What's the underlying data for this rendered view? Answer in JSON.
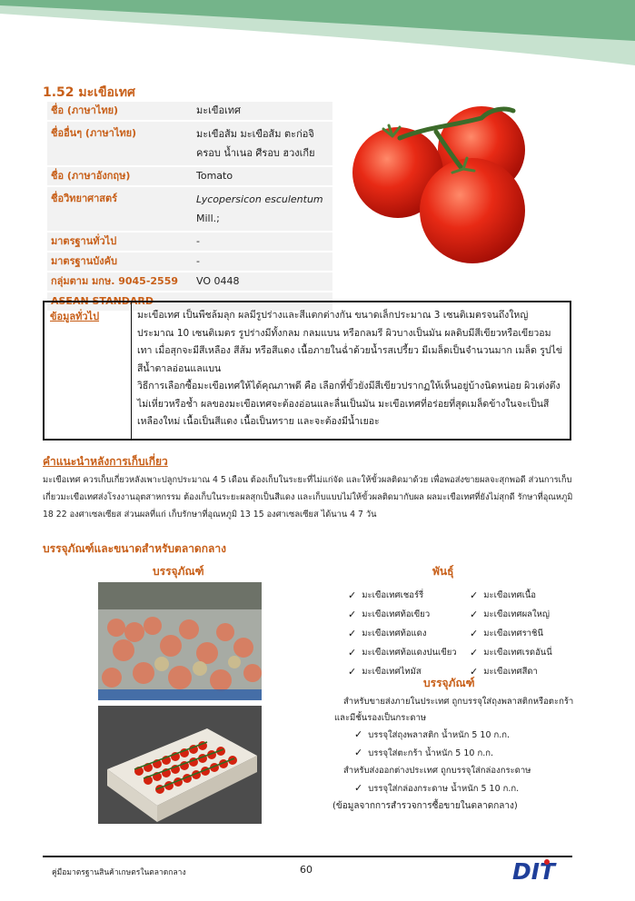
{
  "title": "1.52 มะเขือเทศ",
  "spec": [
    {
      "key": "ชื่อ (ภาษาไทย)",
      "value": "มะเขือเทศ"
    },
    {
      "key": "ชื่ออื่นๆ (ภาษาไทย)",
      "value": "มะเขือส้ม มะเขือส้ม ตะก่อจิ ครอบ น้ำเนอ ศีรอบ ฮวงเกีย"
    },
    {
      "key": "ชื่อ (ภาษาอังกฤษ)",
      "value": "Tomato"
    },
    {
      "key": "ชื่อวิทยาศาสตร์",
      "value_italic": "Lycopersicon esculentum",
      "value_suffix": " Mill.;"
    },
    {
      "key": "มาตรฐานทั่วไป",
      "value": "-"
    },
    {
      "key": "มาตรฐานบังคับ",
      "value": "-"
    },
    {
      "key": "กลุ่มตาม มกษ. 9045-2559",
      "value": "VO 0448"
    },
    {
      "key": "ASEAN STANDARD",
      "value": "-"
    }
  ],
  "general_info": {
    "label": "ข้อมูลทั่วไป",
    "text1": "มะเขือเทศ เป็นพืชล้มลุก ผลมีรูปร่างและสีแตกต่างกัน ขนาดเล็กประมาณ 3 เซนติเมตรจนถึงใหญ่ประมาณ 10 เซนติเมตร รูปร่างมีทั้งกลม กลมแบน หรือกลมรี ผิวบางเป็นมัน ผลดิบมีสีเขียวหรือเขียวอมเทา เมื่อสุกจะมีสีเหลือง สีส้ม หรือสีแดง เนื้อภายในฉ่ำด้วยน้ำรสเปรี้ยว มีเมล็ดเป็นจำนวนมาก เมล็ด รูปไข่สีน้ำตาลอ่อนแลแบน",
    "text2": "วิธีการเลือกซื้อมะเขือเทศให้ได้คุณภาพดี คือ เลือกที่ขั้วยังมีสีเขียวปรากฏให้เห็นอยู่บ้างนิดหน่อย ผิวเต่งตึง ไม่เหี่ยวหรือช้ำ ผลของมะเขือเทศจะต้องอ่อนและลื่นเป็นมัน มะเขือเทศที่อร่อยที่สุดเมล็ดข้างในจะเป็นสีเหลืองใหม่ เนื้อเป็นสีแดง เนื้อเป็นทราย และจะต้องมีน้ำเยอะ"
  },
  "harvest": {
    "heading": "คำแนะนำหลังการเก็บเกี่ยว",
    "text": "มะเขือเทศ ควรเก็บเกี่ยวหลังเพาะปลูกประมาณ 4 5 เดือน ต้องเก็บในระยะที่ไม่แก่จัด และให้ขั้วผลติดมาด้วย เพื่อพอส่งขายผลจะสุกพอดี ส่วนการเก็บเกี่ยวมะเขือเทศส่งโรงงานอุตสาหกรรม ต้องเก็บในระยะผลสุกเป็นสีแดง และเก็บแบบไม่ให้ขั้วผลติดมากับผล ผลมะเขือเทศที่ยังไม่สุกดี รักษาที่อุณหภูมิ 18 22 องศาเซลเซียส ส่วนผลที่แก่ เก็บรักษาที่อุณหภูมิ 13 15 องศาเซลเซียส ได้นาน 4 7 วัน"
  },
  "packaging": {
    "heading": "บรรจุภัณฑ์และขนาดสำหรับตลาดกลาง",
    "left_heading": "บรรจุภัณฑ์",
    "varieties_heading": "พันธุ์",
    "varieties": [
      [
        "มะเขือเทศเชอร์รี่",
        "มะเขือเทศเนื้อ"
      ],
      [
        "มะเขือเทศท้อเขียว",
        "มะเขือเทศผลใหญ่"
      ],
      [
        "มะเขือเทศท้อแดง",
        "มะเขือเทศราชินี"
      ],
      [
        "มะเขือเทศท้อแดงปนเขียว",
        "มะเขือเทศเรดอันนี่"
      ],
      [
        "มะเขือเทศไทมัส",
        "มะเขือเทศสีดา"
      ]
    ],
    "pack_heading": "บรรจุภัณฑ์",
    "domestic": "สำหรับขายส่งภายในประเทศ ถูกบรรจุใส่ถุงพลาสติกหรือตะกร้า และมีชั้นรองเป็นกระดาษ",
    "domestic_items": [
      "บรรจุใส่ถุงพลาสติก น้ำหนัก 5 10 ก.ก.",
      "บรรจุใส่ตะกร้า น้ำหนัก 5 10 ก.ก."
    ],
    "export": "สำหรับส่งออกต่างประเทศ ถูกบรรจุใส่กล่องกระดาษ",
    "export_items": [
      "บรรจุใส่กล่องกระดาษ น้ำหนัก 5 10 ก.ก."
    ],
    "source": "(ข้อมูลจากการสำรวจการซื้อขายในตลาดกลาง)"
  },
  "footer": {
    "text": "คู่มือมาตรฐานสินค้าเกษตรในตลาดกลาง",
    "page": "60",
    "logo_text": "DIT"
  },
  "colors": {
    "accent": "#c8601a",
    "header_green": "#7cb98e"
  }
}
